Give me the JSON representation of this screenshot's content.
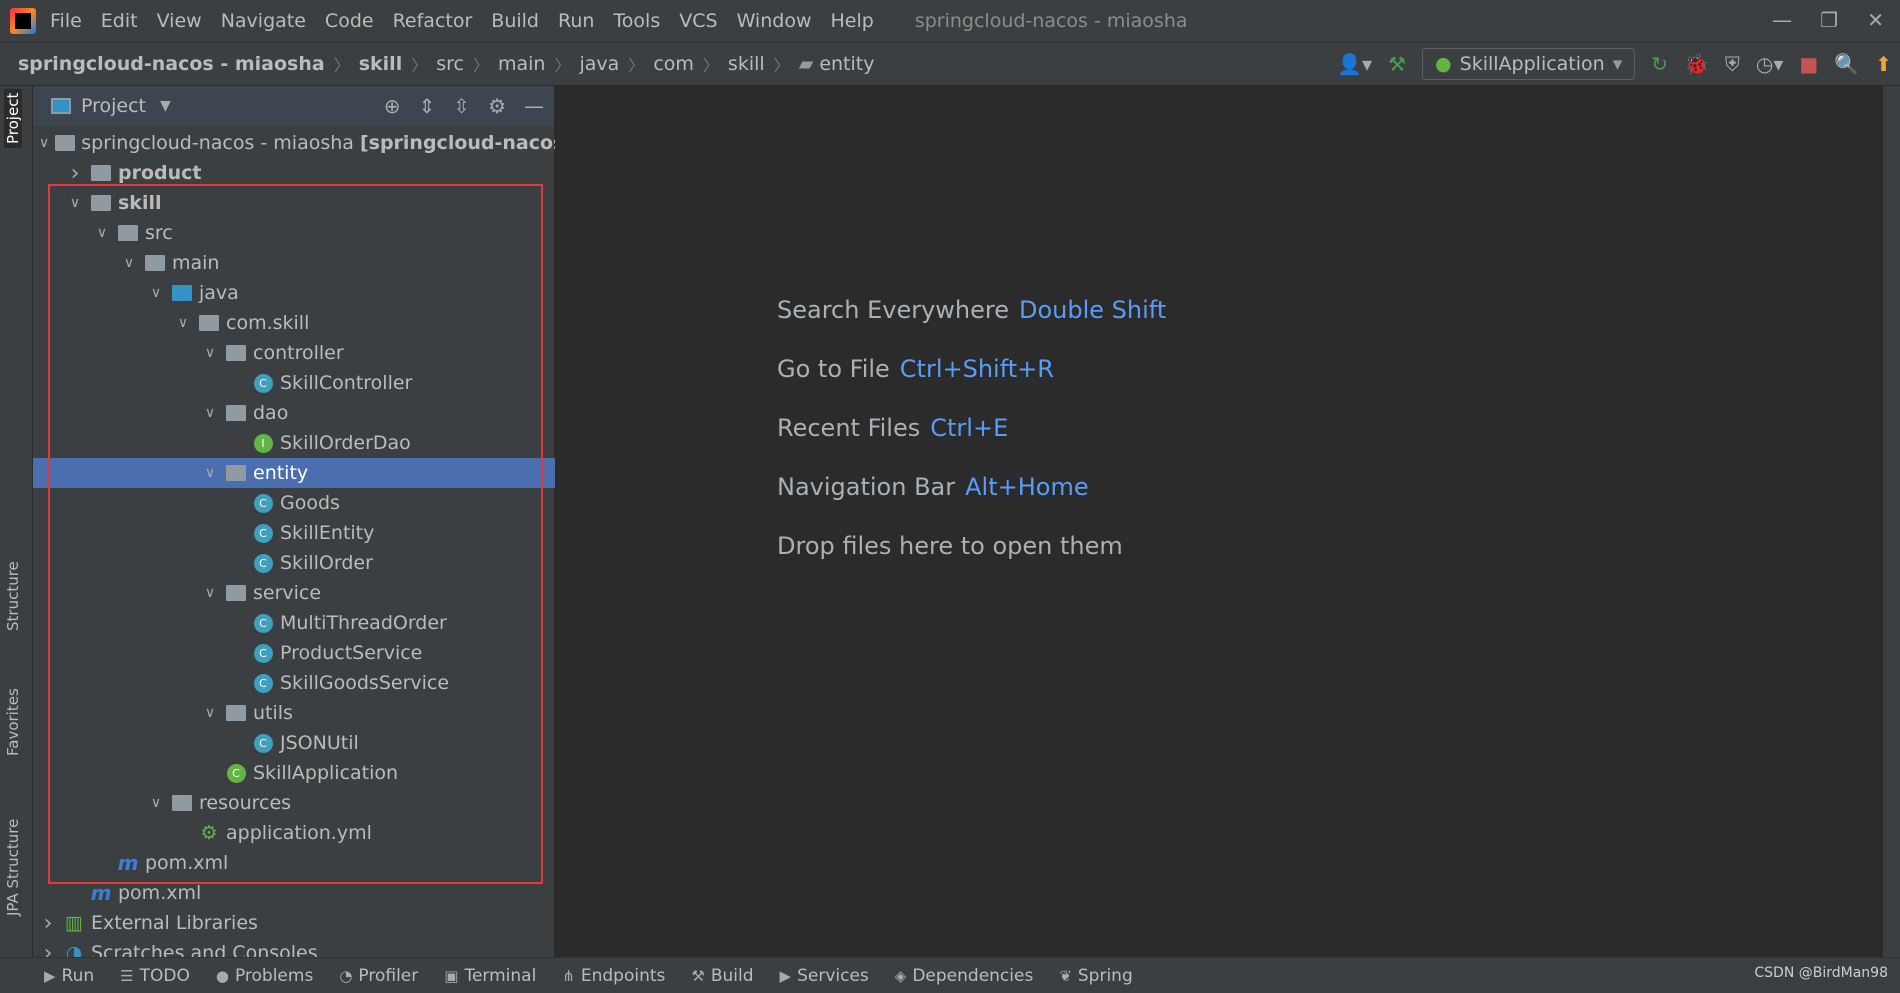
{
  "menubar": {
    "items": [
      "File",
      "Edit",
      "View",
      "Navigate",
      "Code",
      "Refactor",
      "Build",
      "Run",
      "Tools",
      "VCS",
      "Window",
      "Help"
    ],
    "window_title": "springcloud-nacos - miaosha"
  },
  "breadcrumb": [
    "springcloud-nacos - miaosha",
    "skill",
    "src",
    "main",
    "java",
    "com",
    "skill",
    "entity"
  ],
  "toolbar": {
    "run_config": "SkillApplication"
  },
  "left_strip": {
    "tabs": [
      "Project",
      "Structure",
      "Favorites",
      "JPA Structure"
    ]
  },
  "project_panel": {
    "title": "Project",
    "tree": [
      {
        "label": "springcloud-nacos - miaosha",
        "suffix": "[springcloud-nacos]",
        "level": 0,
        "chev": "open",
        "icon": "module-folder"
      },
      {
        "label": "product",
        "level": 1,
        "chev": "closed",
        "icon": "module-folder",
        "bold": true
      },
      {
        "label": "skill",
        "level": 1,
        "chev": "open",
        "icon": "module-folder",
        "bold": true
      },
      {
        "label": "src",
        "level": 2,
        "chev": "open",
        "icon": "folder"
      },
      {
        "label": "main",
        "level": 3,
        "chev": "open",
        "icon": "folder"
      },
      {
        "label": "java",
        "level": 4,
        "chev": "open",
        "icon": "source-folder"
      },
      {
        "label": "com.skill",
        "level": 5,
        "chev": "open",
        "icon": "package"
      },
      {
        "label": "controller",
        "level": 6,
        "chev": "open",
        "icon": "package"
      },
      {
        "label": "SkillController",
        "level": 7,
        "icon": "class"
      },
      {
        "label": "dao",
        "level": 6,
        "chev": "open",
        "icon": "package"
      },
      {
        "label": "SkillOrderDao",
        "level": 7,
        "icon": "interface"
      },
      {
        "label": "entity",
        "level": 6,
        "chev": "open",
        "icon": "package",
        "selected": true
      },
      {
        "label": "Goods",
        "level": 7,
        "icon": "class"
      },
      {
        "label": "SkillEntity",
        "level": 7,
        "icon": "class"
      },
      {
        "label": "SkillOrder",
        "level": 7,
        "icon": "class"
      },
      {
        "label": "service",
        "level": 6,
        "chev": "open",
        "icon": "package"
      },
      {
        "label": "MultiThreadOrder",
        "level": 7,
        "icon": "class"
      },
      {
        "label": "ProductService",
        "level": 7,
        "icon": "class"
      },
      {
        "label": "SkillGoodsService",
        "level": 7,
        "icon": "class"
      },
      {
        "label": "utils",
        "level": 6,
        "chev": "open",
        "icon": "package"
      },
      {
        "label": "JSONUtil",
        "level": 7,
        "icon": "class"
      },
      {
        "label": "SkillApplication",
        "level": 6,
        "icon": "spring-boot-class"
      },
      {
        "label": "resources",
        "level": 4,
        "chev": "open",
        "icon": "resources-folder"
      },
      {
        "label": "application.yml",
        "level": 5,
        "icon": "yml"
      },
      {
        "label": "pom.xml",
        "level": 2,
        "icon": "maven"
      },
      {
        "label": "pom.xml",
        "level": 1,
        "icon": "maven"
      },
      {
        "label": "External Libraries",
        "level": 0,
        "chev": "closed",
        "icon": "libraries"
      },
      {
        "label": "Scratches and Consoles",
        "level": 0,
        "chev": "closed",
        "icon": "scratches"
      }
    ]
  },
  "editor": {
    "hints": [
      {
        "label": "Search Everywhere",
        "key": "Double Shift"
      },
      {
        "label": "Go to File",
        "key": "Ctrl+Shift+R"
      },
      {
        "label": "Recent Files",
        "key": "Ctrl+E"
      },
      {
        "label": "Navigation Bar",
        "key": "Alt+Home"
      },
      {
        "label": "Drop files here to open them",
        "key": ""
      }
    ]
  },
  "bottom_tabs": [
    {
      "label": "Run",
      "icon": "▶"
    },
    {
      "label": "TODO",
      "icon": "☰"
    },
    {
      "label": "Problems",
      "icon": "●"
    },
    {
      "label": "Profiler",
      "icon": "◔"
    },
    {
      "label": "Terminal",
      "icon": "▣"
    },
    {
      "label": "Endpoints",
      "icon": "⋔"
    },
    {
      "label": "Build",
      "icon": "⚒"
    },
    {
      "label": "Services",
      "icon": "▶"
    },
    {
      "label": "Dependencies",
      "icon": "◈"
    },
    {
      "label": "Spring",
      "icon": "❦"
    }
  ],
  "watermark": "CSDN @BirdMan98",
  "colors": {
    "selection": "#4b6eaf",
    "highlight_box": "#e53935",
    "shortcut": "#589df6"
  }
}
